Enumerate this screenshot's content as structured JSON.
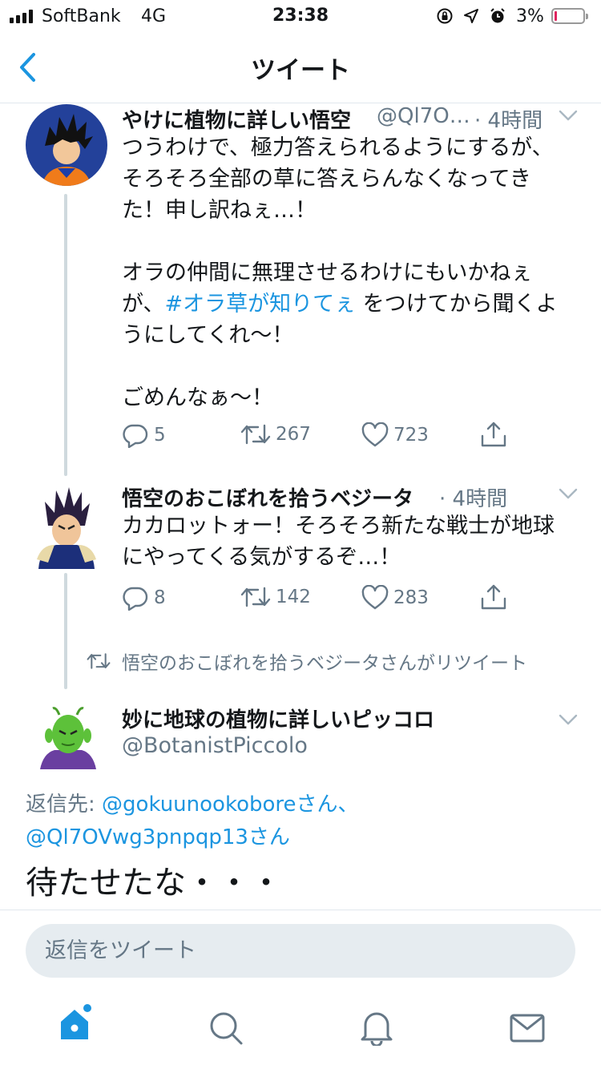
{
  "status_bar": {
    "carrier": "SoftBank",
    "network": "4G",
    "time": "23:38",
    "battery_percent": "3%",
    "battery_level": 0.03
  },
  "nav": {
    "title": "ツイート",
    "back_icon": "chevron-left-icon"
  },
  "tweets": [
    {
      "name": "やけに植物に詳しい悟空",
      "handle": "@Ql7O…",
      "time": "· 4時間",
      "body_part1": "つうわけで、極力答えられるようにするが、\nそろそろ全部の草に答えらんなくなってき\nた！申し訳ねぇ…！\n\nオラの仲間に無理させるわけにもいかねぇ\nが、",
      "hashtag": "#オラ草が知りてぇ",
      "body_part2": " をつけてから聞くよ\nうにしてくれ〜！\n\nごめんなぁ〜！",
      "replies": "5",
      "retweets": "267",
      "likes": "723"
    },
    {
      "name": "悟空のおこぼれを拾うベジータ",
      "time": "· 4時間",
      "body": "カカロットォー！そろそろ新たな戦士が地球\nにやってくる気がするぞ…！",
      "replies": "8",
      "retweets": "142",
      "likes": "283"
    }
  ],
  "retweet_notice": "悟空のおこぼれを拾うベジータさんがリツイート",
  "main_tweet": {
    "name": "妙に地球の植物に詳しいピッコロ",
    "handle": "@BotanistPiccolo",
    "reply_to_label": "返信先:",
    "reply_to_1": "@gokuunookoboreさん、",
    "reply_to_2": "@Ql7OVwg3pnpqp13さん",
    "body": "待たせたな・・・"
  },
  "reply_input": {
    "placeholder": "返信をツイート"
  },
  "tab_bar": {
    "items": [
      "home-icon",
      "search-icon",
      "notifications-icon",
      "messages-icon"
    ],
    "active": "home-icon"
  },
  "colors": {
    "accent": "#1b95e0",
    "secondary_text": "#657786",
    "battery_low": "#e0245e"
  }
}
